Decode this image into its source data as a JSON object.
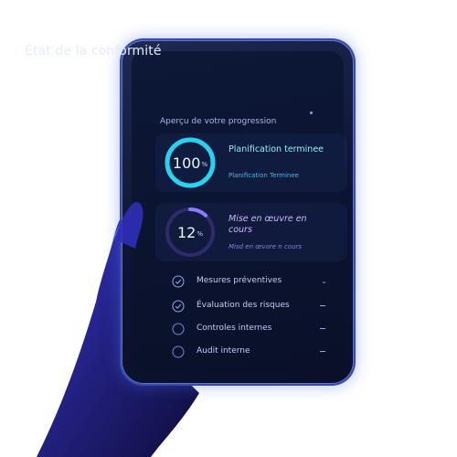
{
  "header": {
    "title": "État de la conformité",
    "subtitle": "Aperçu de votre progression"
  },
  "progress_cards": [
    {
      "value": "100",
      "percent": 1.0,
      "unit": "%",
      "title": "Planification terminee",
      "subtitle": "Planification Terminee",
      "color": "#27d4f0"
    },
    {
      "value": "12",
      "percent": 0.12,
      "unit": "%",
      "title": "Mise en œuvre en cours",
      "subtitle": "Misd en œvore n cours",
      "color": "#8b7bff"
    }
  ],
  "checklist": [
    {
      "label": "Mesures préventives",
      "icon": "check-circle-icon",
      "trailing": "chevron-down-icon"
    },
    {
      "label": "Évaluation des risques",
      "icon": "check-circle-icon",
      "trailing": "dash-icon"
    },
    {
      "label": "Controles internes",
      "icon": "circle-icon",
      "trailing": "dash-icon"
    },
    {
      "label": "Audit interne",
      "icon": "circle-icon",
      "trailing": "dash-icon"
    }
  ]
}
